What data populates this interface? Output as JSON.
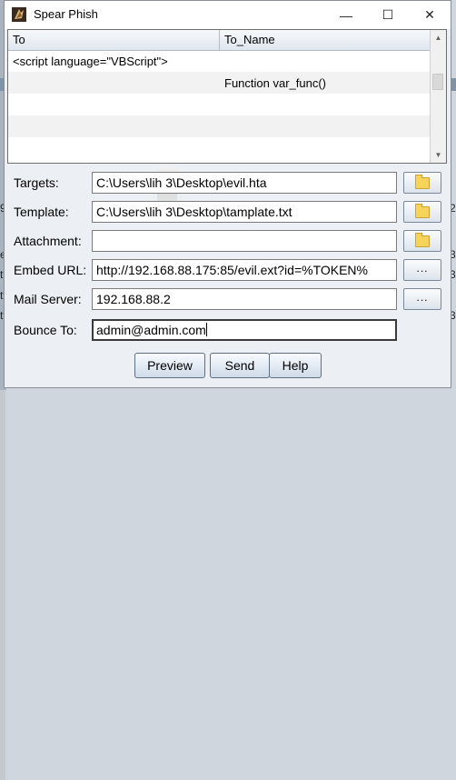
{
  "window": {
    "title": "Spear Phish",
    "icon": "app-icon"
  },
  "controls": {
    "minimize": "—",
    "maximize": "☐",
    "close": "✕"
  },
  "table": {
    "columns": [
      "To",
      "To_Name"
    ],
    "rows": [
      [
        "<script language=\"VBScript\">",
        ""
      ],
      [
        "",
        "Function var_func()"
      ],
      [
        "",
        ""
      ],
      [
        "",
        ""
      ],
      [
        "",
        ""
      ]
    ]
  },
  "form": {
    "targets": {
      "label": "Targets:",
      "value": "C:\\Users\\lih      3\\Desktop\\evil.hta",
      "button": "folder-icon"
    },
    "template": {
      "label": "Template:",
      "value": "C:\\Users\\lih      3\\Desktop\\tamplate.txt",
      "button": "folder-icon"
    },
    "attachment": {
      "label": "Attachment:",
      "value": "",
      "button": "folder-icon"
    },
    "embed_url": {
      "label": "Embed URL:",
      "value": "http://192.168.88.175:85/evil.ext?id=%TOKEN%",
      "button": "..."
    },
    "mail_server": {
      "label": "Mail Server:",
      "value": "192.168.88.2",
      "button": "..."
    },
    "bounce_to": {
      "label": "Bounce To:",
      "value": "admin@admin.com"
    }
  },
  "actions": {
    "preview": "Preview",
    "send": "Send",
    "help": "Help"
  },
  "background": {
    "left_chars": [
      "9",
      "e",
      "tt",
      "tt",
      "tt"
    ],
    "right_chars": [
      "2",
      "3",
      "3",
      "3"
    ]
  }
}
